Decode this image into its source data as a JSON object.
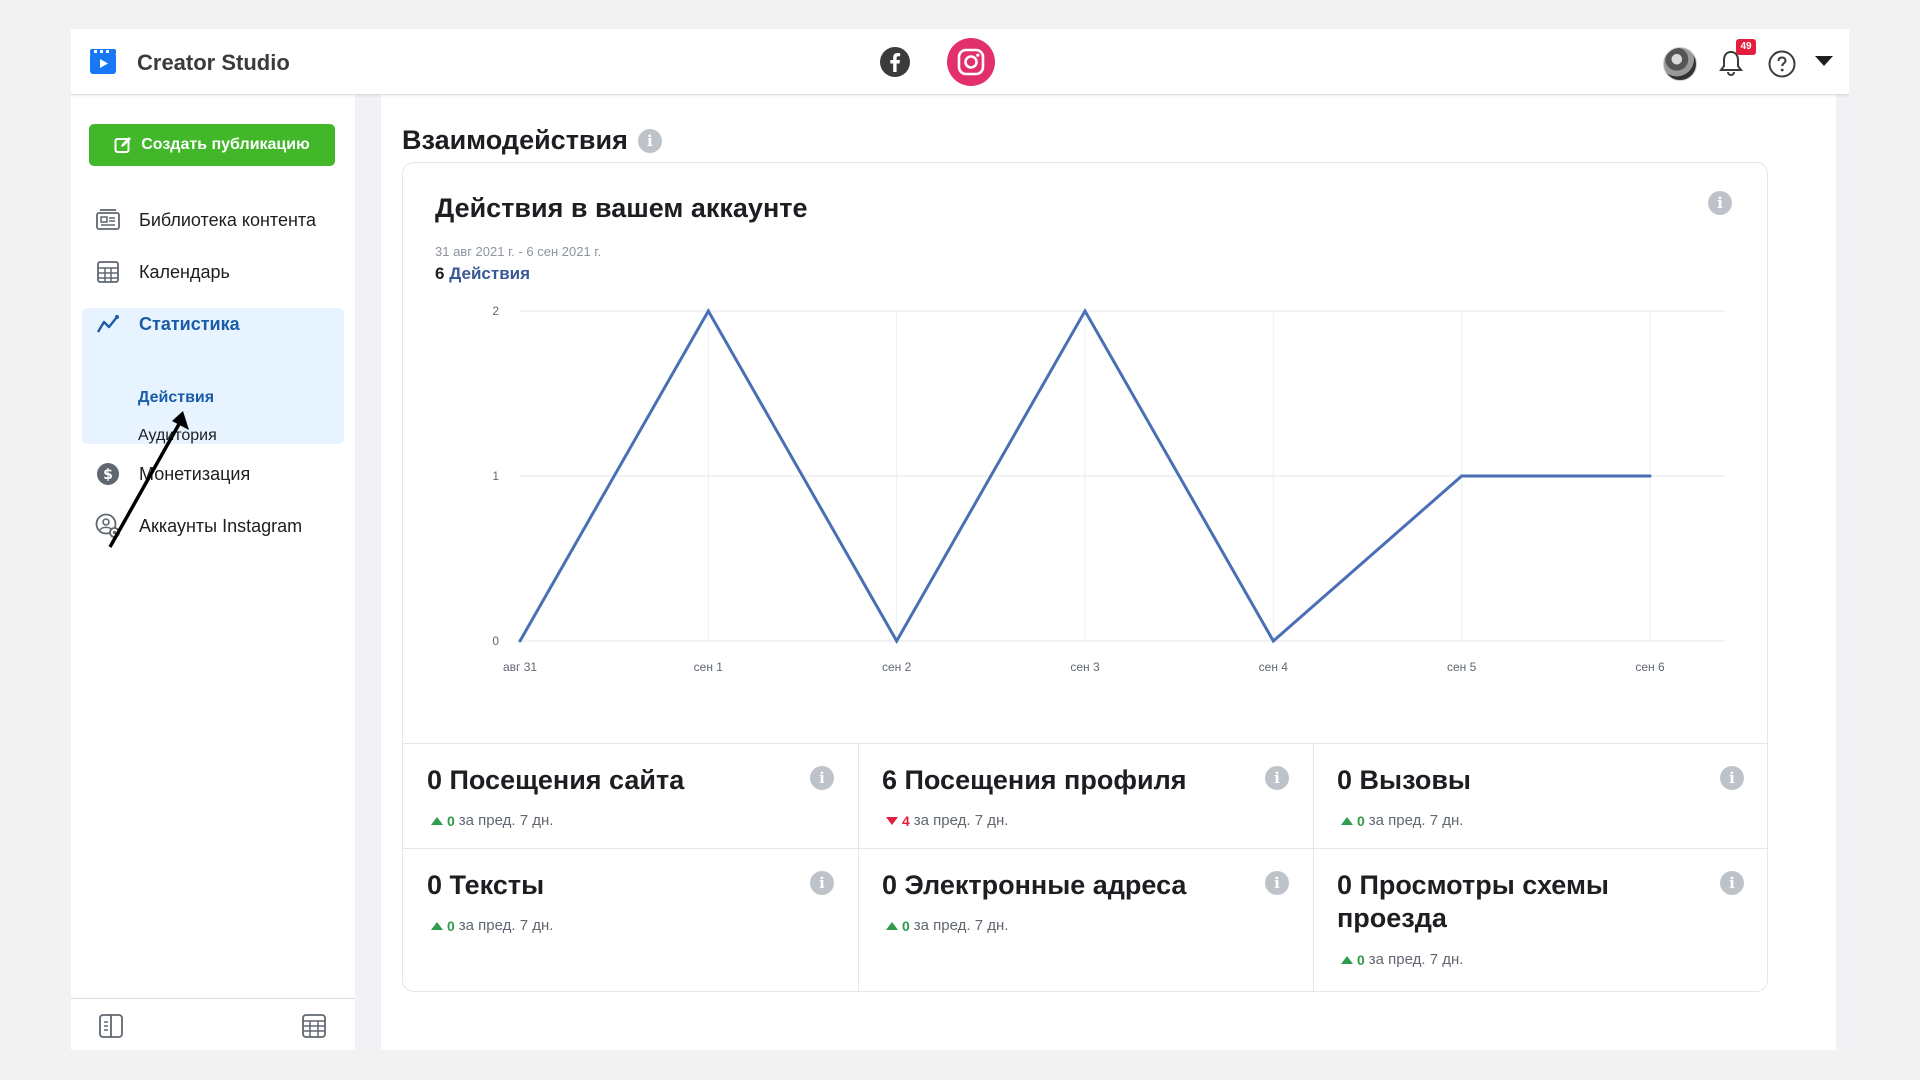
{
  "app": {
    "title": "Creator Studio"
  },
  "header": {
    "notification_count": "49"
  },
  "sidebar": {
    "create_button": "Создать публикацию",
    "items": [
      {
        "label": "Библиотека контента",
        "icon": "content-library-icon"
      },
      {
        "label": "Календарь",
        "icon": "calendar-icon"
      },
      {
        "label": "Статистика",
        "icon": "insights-icon"
      },
      {
        "label": "Монетизация",
        "icon": "dollar-icon"
      },
      {
        "label": "Аккаунты Instagram",
        "icon": "account-settings-icon"
      }
    ],
    "subitems": [
      {
        "label": "Действия"
      },
      {
        "label": "Аудитория"
      }
    ]
  },
  "main": {
    "section_title": "Взаимодействия",
    "card": {
      "title": "Действия в вашем аккаунте",
      "date_range": "31 авг 2021 г. - 6 сен 2021 г.",
      "total_value": "6",
      "total_label": "Действия"
    },
    "metrics": [
      {
        "title": "0 Посещения сайта",
        "delta": "0",
        "direction": "up",
        "suffix": "за пред. 7 дн."
      },
      {
        "title": "6 Посещения профиля",
        "delta": "4",
        "direction": "down",
        "suffix": "за пред. 7 дн."
      },
      {
        "title": "0 Вызовы",
        "delta": "0",
        "direction": "up",
        "suffix": "за пред. 7 дн."
      },
      {
        "title": "0 Тексты",
        "delta": "0",
        "direction": "up",
        "suffix": "за пред. 7 дн."
      },
      {
        "title": "0 Электронные адреса",
        "delta": "0",
        "direction": "up",
        "suffix": "за пред. 7 дн."
      },
      {
        "title": "0 Просмотры схемы проезда",
        "delta": "0",
        "direction": "up",
        "suffix": "за пред. 7 дн."
      }
    ]
  },
  "colors": {
    "accent": "#1a5ca8",
    "create_button": "#42b72a",
    "instagram": "#e1306c",
    "line": "#4a6fb5",
    "up": "#2e9c4a",
    "down": "#e41e3f"
  },
  "chart_data": {
    "type": "line",
    "categories": [
      "авг 31",
      "сен 1",
      "сен 2",
      "сен 3",
      "сен 4",
      "сен 5",
      "сен 6"
    ],
    "series": [
      {
        "values": [
          0,
          2,
          0,
          2,
          0,
          1,
          1
        ]
      }
    ],
    "yticks": [
      "0",
      "1",
      "2"
    ],
    "ylim": [
      0,
      2
    ],
    "grid": true
  }
}
